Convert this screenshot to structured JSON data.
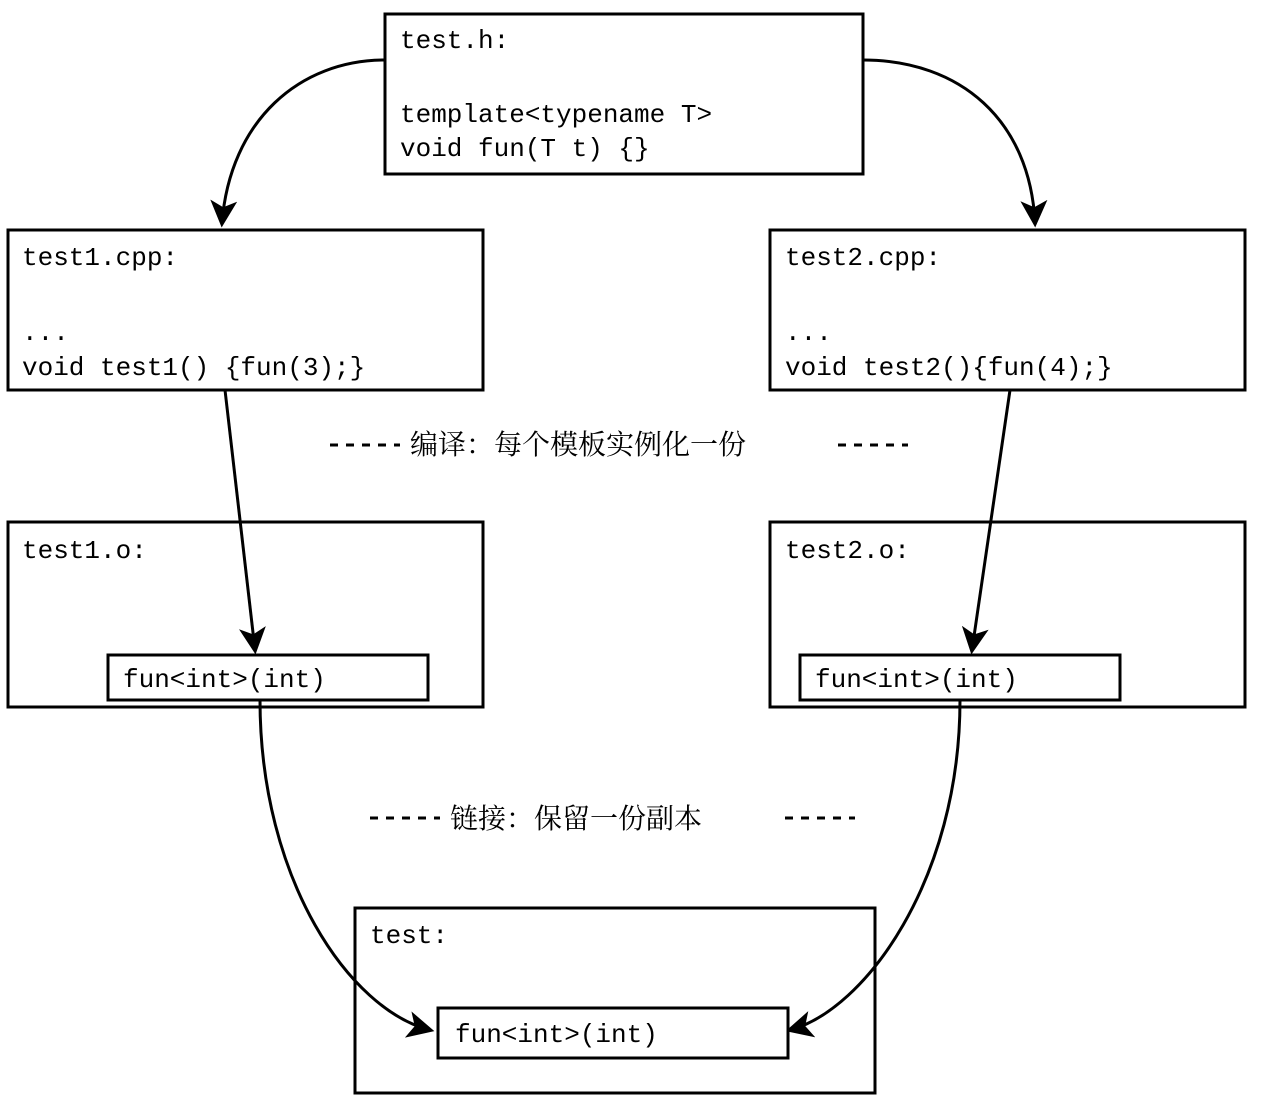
{
  "header": {
    "title": "test.h:",
    "line1": "template<typename T>",
    "line2": "void fun(T t) {}"
  },
  "left_cpp": {
    "title": "test1.cpp:",
    "ellipsis": "...",
    "code": "void test1() {fun(3);}"
  },
  "right_cpp": {
    "title": "test2.cpp:",
    "ellipsis": "...",
    "code": "void test2(){fun(4);}"
  },
  "stage1_label": "编译：每个模板实例化一份",
  "left_obj": {
    "title": "test1.o:",
    "instantiation": "fun<int>(int)"
  },
  "right_obj": {
    "title": "test2.o:",
    "instantiation": "fun<int>(int)"
  },
  "stage2_label": "链接：保留一份副本",
  "final": {
    "title": "test:",
    "instantiation": "fun<int>(int)"
  }
}
